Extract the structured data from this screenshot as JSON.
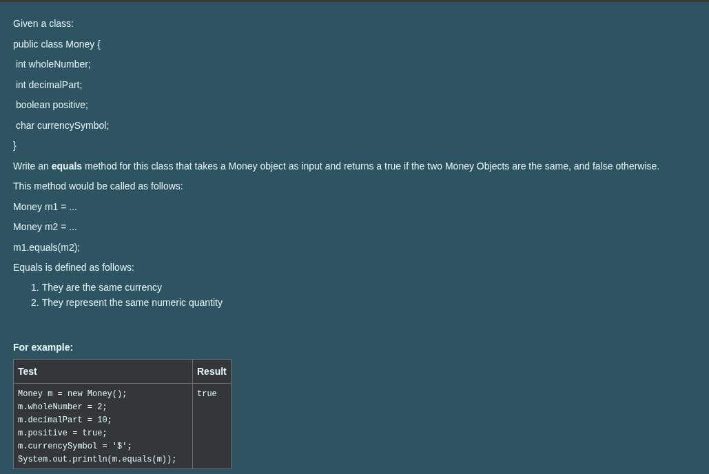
{
  "question": {
    "paragraphs": [
      "Given a class:",
      "public class Money {",
      " int wholeNumber;",
      " int decimalPart;",
      " boolean positive;",
      " char currencySymbol;",
      "}",
      "Write an **equals** method for this class that takes a Money object as input and returns a true if the two Money Objects are the same, and false otherwise.",
      "This method would be called as follows:",
      "Money m1 = ...",
      "Money m2 = ...",
      "m1.equals(m2);",
      "Equals is defined as follows:"
    ],
    "list_items": [
      {
        "marker": "1.",
        "text": "They are the same currency"
      },
      {
        "marker": "2.",
        "text": "They represent the same numeric quantity"
      }
    ]
  },
  "example": {
    "heading": "For example:",
    "table": {
      "columns": [
        "Test",
        "Result"
      ],
      "rows": [
        {
          "test": "Money m = new Money();\nm.wholeNumber = 2;\nm.decimalPart = 10;\nm.positive = true;\nm.currencySymbol = '$';\nSystem.out.println(m.equals(m));",
          "result": "true"
        }
      ]
    }
  }
}
